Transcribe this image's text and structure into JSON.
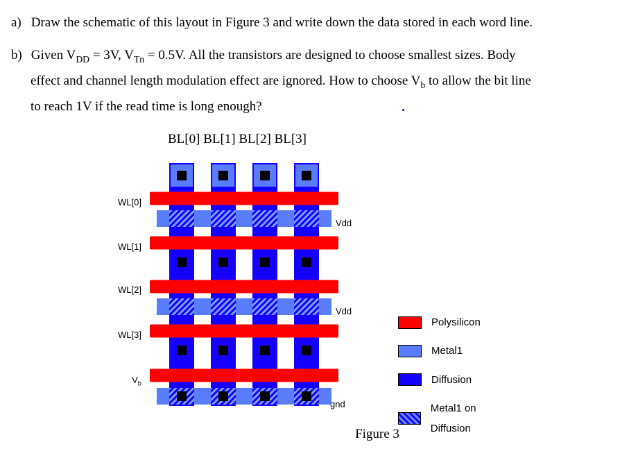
{
  "questions": {
    "a": {
      "label": "a)",
      "text": "Draw the schematic of this layout in Figure 3 and write down the data stored in each word line."
    },
    "b": {
      "label": "b)",
      "line1_pre": "Given V",
      "vdd_sub": "DD",
      "line1_mid": " = 3V, V",
      "vtn_sub": "Tn",
      "line1_post": " = 0.5V. All the transistors are designed to choose smallest sizes. Body",
      "line2_pre": "effect and channel length modulation effect are ignored. How to choose V",
      "vb_sub": "b",
      "line2_post": " to allow the bit line",
      "line3": "to reach 1V if the read time is long enough?"
    }
  },
  "bl_header": {
    "items": [
      "BL[0]",
      "BL[1]",
      "BL[2]",
      "BL[3]"
    ]
  },
  "left_labels": {
    "wl0": "WL[0]",
    "wl1": "WL[1]",
    "wl2": "WL[2]",
    "wl3": "WL[3]",
    "vb_pre": "V",
    "vb_sub": "b"
  },
  "right_labels": {
    "vdd1": "Vdd",
    "vdd2": "Vdd",
    "gnd": "gnd"
  },
  "legend": {
    "poly": "Polysilicon",
    "metal1": "Metal1",
    "diff": "Diffusion",
    "m1d": "Metal1 on Diffusion"
  },
  "caption": "Figure 3",
  "chart_data": {
    "type": "table",
    "description": "ROM layout (mask layers). Vertical bitlines BL[0..3] (diffusion) intersected by horizontal wordlines WL[0..3] (polysilicon). Horizontal Metal1 rails between WL pairs = Vdd; bottom Metal1 rail = gnd; bottom poly gate row = Vb bias. Contact squares top row tie bitlines to Metal1 studs.",
    "bitlines": [
      "BL[0]",
      "BL[1]",
      "BL[2]",
      "BL[3]"
    ],
    "wordlines": [
      "WL[0]",
      "WL[1]",
      "WL[2]",
      "WL[3]"
    ],
    "rails": {
      "after_WL0": "Vdd",
      "after_WL2": "Vdd",
      "bottom": "gnd"
    },
    "bias_gate": "Vb",
    "given": {
      "VDD_V": 3,
      "VTn_V": 0.5,
      "target_bitline_V": 1
    }
  }
}
